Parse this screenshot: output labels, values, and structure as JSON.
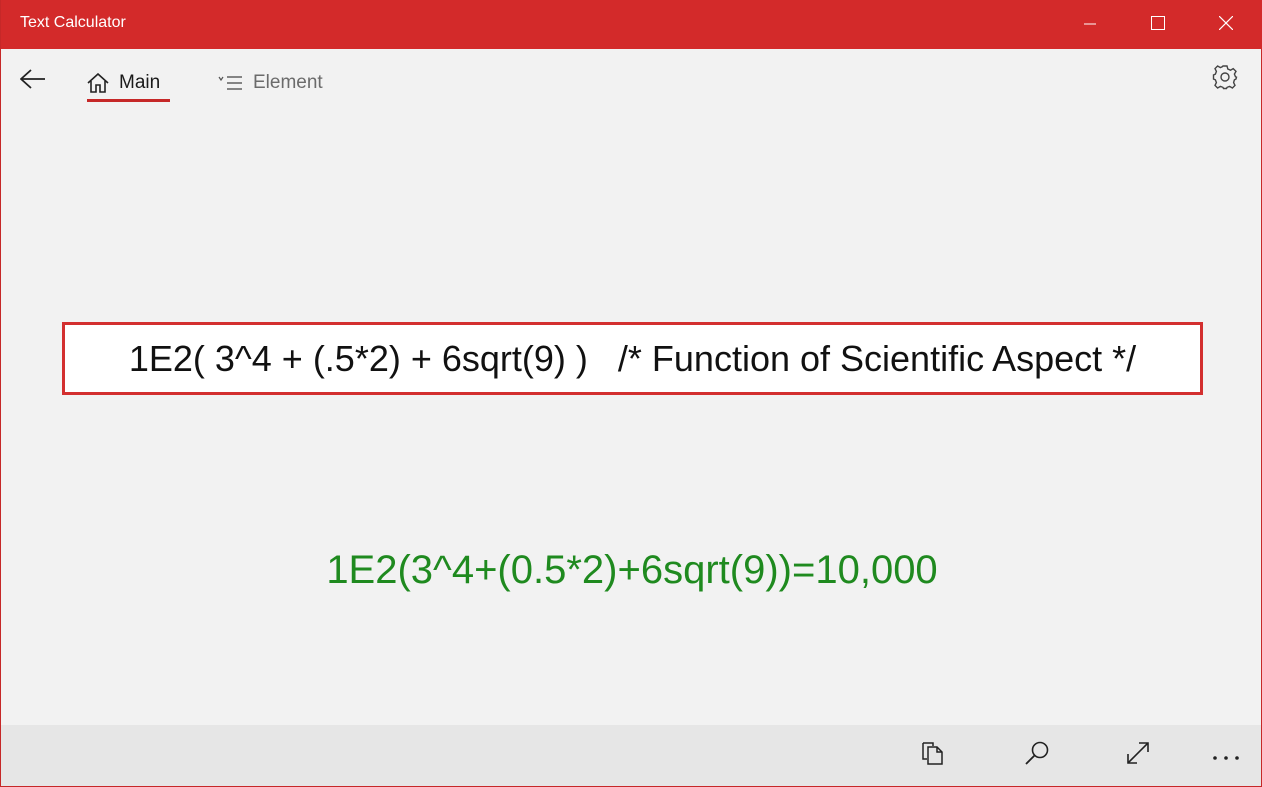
{
  "app": {
    "title": "Text Calculator"
  },
  "window_controls": {
    "minimize_icon": "minimize-icon",
    "maximize_icon": "maximize-icon",
    "close_icon": "close-icon"
  },
  "nav": {
    "back_icon": "back-arrow-icon",
    "tabs": [
      {
        "label": "Main",
        "icon": "home-icon",
        "selected": true
      },
      {
        "label": "Element",
        "icon": "list-icon",
        "selected": false
      }
    ],
    "settings_icon": "gear-icon"
  },
  "content": {
    "expression": "1E2( 3^4 + (.5*2) + 6sqrt(9) )   /* Function of Scientific Aspect */",
    "result": "1E2(3^4+(0.5*2)+6sqrt(9))=10,000"
  },
  "command_bar": {
    "items": [
      {
        "icon": "copy-icon"
      },
      {
        "icon": "search-icon"
      },
      {
        "icon": "expand-icon"
      },
      {
        "icon": "more-icon"
      }
    ]
  },
  "colors": {
    "accent": "#d32a2a",
    "result_text": "#1f8a1f",
    "background": "#f2f2f2",
    "command_bar": "#e6e6e6"
  }
}
